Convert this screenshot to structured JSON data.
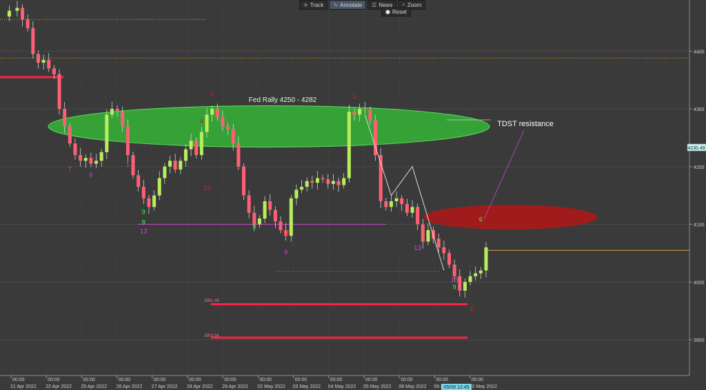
{
  "toolbar": {
    "track": "Track",
    "annotate": "Annotate",
    "news": "News",
    "zoom": "Zoom",
    "reset": "Reset"
  },
  "annotations": {
    "fed_rally": "Fed Rally 4250 - 4282",
    "tdst_resistance": "TDST resistance",
    "price_marker": "4230.48",
    "crosshair_label": "05/09 12:45",
    "level_3961": "3961.48",
    "level_3903": "3903.56"
  },
  "colors": {
    "background": "#3a3a3a",
    "grid": "#4b4b4b",
    "bull_candle": "#b8ee5a",
    "bear_candle": "#ff5f74",
    "fed_zone": "#34c934",
    "tdst_zone": "#b31818",
    "support_line": "#ff2244",
    "resistance_dotted": "#d4a23a",
    "setup_green": "#33ff55",
    "setup_purple": "#cc44cc",
    "setup_red": "#cc2222"
  },
  "chart_data": {
    "type": "candlestick",
    "y_axis": {
      "ticks": [
        3900,
        4000,
        4100,
        4200,
        4300,
        4400
      ],
      "range": [
        3830,
        4500
      ]
    },
    "x_axis": {
      "labels": [
        {
          "time": "00:00",
          "date": "21 Apr 2022"
        },
        {
          "time": "00:00",
          "date": "22 Apr 2022"
        },
        {
          "time": "00:00",
          "date": "25 Apr 2022"
        },
        {
          "time": "00:00",
          "date": "26 Apr 2022"
        },
        {
          "time": "00:00",
          "date": "27 Apr 2022"
        },
        {
          "time": "00:00",
          "date": "28 Apr 2022"
        },
        {
          "time": "00:00",
          "date": "29 Apr 2022"
        },
        {
          "time": "00:00",
          "date": "02 May 2022"
        },
        {
          "time": "00:00",
          "date": "03 May 2022"
        },
        {
          "time": "00:00",
          "date": "04 May 2022"
        },
        {
          "time": "00:00",
          "date": "05 May 2022"
        },
        {
          "time": "00:00",
          "date": "06 May 2022"
        },
        {
          "time": "00:00",
          "date": "09 May 2022"
        },
        {
          "time": "00:00",
          "date": "10 May 2022"
        }
      ]
    },
    "price_path": [
      [
        0,
        4460
      ],
      [
        3,
        4470
      ],
      [
        6,
        4475
      ],
      [
        8,
        4455
      ],
      [
        10,
        4440
      ],
      [
        12,
        4395
      ],
      [
        14,
        4380
      ],
      [
        16,
        4385
      ],
      [
        18,
        4370
      ],
      [
        20,
        4360
      ],
      [
        22,
        4300
      ],
      [
        24,
        4270
      ],
      [
        26,
        4240
      ],
      [
        28,
        4220
      ],
      [
        30,
        4210
      ],
      [
        32,
        4215
      ],
      [
        34,
        4205
      ],
      [
        36,
        4210
      ],
      [
        38,
        4225
      ],
      [
        40,
        4290
      ],
      [
        42,
        4300
      ],
      [
        44,
        4295
      ],
      [
        46,
        4270
      ],
      [
        48,
        4220
      ],
      [
        50,
        4185
      ],
      [
        52,
        4165
      ],
      [
        54,
        4145
      ],
      [
        56,
        4130
      ],
      [
        58,
        4150
      ],
      [
        60,
        4180
      ],
      [
        62,
        4200
      ],
      [
        64,
        4210
      ],
      [
        66,
        4195
      ],
      [
        68,
        4210
      ],
      [
        70,
        4230
      ],
      [
        72,
        4245
      ],
      [
        74,
        4220
      ],
      [
        76,
        4260
      ],
      [
        78,
        4290
      ],
      [
        80,
        4300
      ],
      [
        82,
        4285
      ],
      [
        84,
        4270
      ],
      [
        86,
        4265
      ],
      [
        88,
        4240
      ],
      [
        90,
        4200
      ],
      [
        92,
        4150
      ],
      [
        94,
        4120
      ],
      [
        96,
        4100
      ],
      [
        98,
        4110
      ],
      [
        100,
        4140
      ],
      [
        102,
        4125
      ],
      [
        104,
        4105
      ],
      [
        106,
        4090
      ],
      [
        108,
        4080
      ],
      [
        110,
        4145
      ],
      [
        112,
        4160
      ],
      [
        114,
        4165
      ],
      [
        116,
        4175
      ],
      [
        118,
        4172
      ],
      [
        120,
        4180
      ],
      [
        122,
        4178
      ],
      [
        124,
        4170
      ],
      [
        126,
        4175
      ],
      [
        128,
        4168
      ],
      [
        130,
        4180
      ],
      [
        132,
        4295
      ],
      [
        134,
        4290
      ],
      [
        136,
        4300
      ],
      [
        138,
        4298
      ],
      [
        140,
        4280
      ],
      [
        142,
        4220
      ],
      [
        144,
        4140
      ],
      [
        146,
        4130
      ],
      [
        148,
        4140
      ],
      [
        150,
        4145
      ],
      [
        152,
        4135
      ],
      [
        154,
        4120
      ],
      [
        156,
        4130
      ],
      [
        158,
        4100
      ],
      [
        160,
        4070
      ],
      [
        162,
        4090
      ],
      [
        164,
        4075
      ],
      [
        166,
        4060
      ],
      [
        168,
        4050
      ],
      [
        170,
        4030
      ],
      [
        172,
        4010
      ],
      [
        174,
        3985
      ],
      [
        176,
        4000
      ],
      [
        178,
        4010
      ],
      [
        180,
        4015
      ],
      [
        182,
        4020
      ],
      [
        184,
        4060
      ]
    ],
    "horizontal_levels": [
      {
        "price": 4455,
        "style": "dotted",
        "color": "resistance_dotted"
      },
      {
        "price": 4388,
        "style": "dotted",
        "color": "resistance_dotted"
      },
      {
        "price": 4355,
        "style": "solid",
        "color": "support_line"
      },
      {
        "price": 4100,
        "style": "solid",
        "color": "setup_purple"
      },
      {
        "price": 4055,
        "style": "solid",
        "color": "resistance_dotted"
      },
      {
        "price": 4018,
        "style": "dotted",
        "color": "setup_purple"
      },
      {
        "price": 3961.48,
        "style": "solid",
        "color": "support_line"
      },
      {
        "price": 3903.56,
        "style": "solid",
        "color": "support_line"
      }
    ],
    "zones": [
      {
        "name": "fed_rally",
        "low": 4250,
        "high": 4282
      },
      {
        "name": "tdst",
        "low": 4090,
        "high": 4125
      }
    ],
    "setup_labels": [
      {
        "i": 26,
        "price": 4192,
        "text": "7",
        "color": "setup_purple"
      },
      {
        "i": 34,
        "price": 4182,
        "text": "9",
        "color": "setup_purple"
      },
      {
        "i": 48,
        "price": 4200,
        "text": "1",
        "color": "setup_purple"
      },
      {
        "i": 54,
        "price": 4118,
        "text": "9",
        "color": "setup_green"
      },
      {
        "i": 54,
        "price": 4100,
        "text": "8",
        "color": "setup_green"
      },
      {
        "i": 54,
        "price": 4084,
        "text": "13",
        "color": "setup_purple"
      },
      {
        "i": 76,
        "price": 4275,
        "text": "A",
        "color": "setup_red"
      },
      {
        "i": 78,
        "price": 4160,
        "text": "13",
        "color": "setup_red"
      },
      {
        "i": 80,
        "price": 4322,
        "text": "C",
        "color": "setup_red"
      },
      {
        "i": 96,
        "price": 4092,
        "text": "9",
        "color": "setup_green"
      },
      {
        "i": 108,
        "price": 4082,
        "text": "13",
        "color": "setup_red"
      },
      {
        "i": 108,
        "price": 4048,
        "text": "9",
        "color": "setup_purple"
      },
      {
        "i": 134,
        "price": 4318,
        "text": "2",
        "color": "setup_red"
      },
      {
        "i": 158,
        "price": 4055,
        "text": "13",
        "color": "setup_purple"
      },
      {
        "i": 172,
        "price": 4000,
        "text": "13",
        "color": "setup_purple"
      },
      {
        "i": 172,
        "price": 3988,
        "text": "9",
        "color": "setup_green"
      },
      {
        "i": 179,
        "price": 3950,
        "text": "C",
        "color": "setup_red"
      },
      {
        "i": 182,
        "price": 4105,
        "text": "6",
        "color": "setup_green"
      }
    ]
  }
}
